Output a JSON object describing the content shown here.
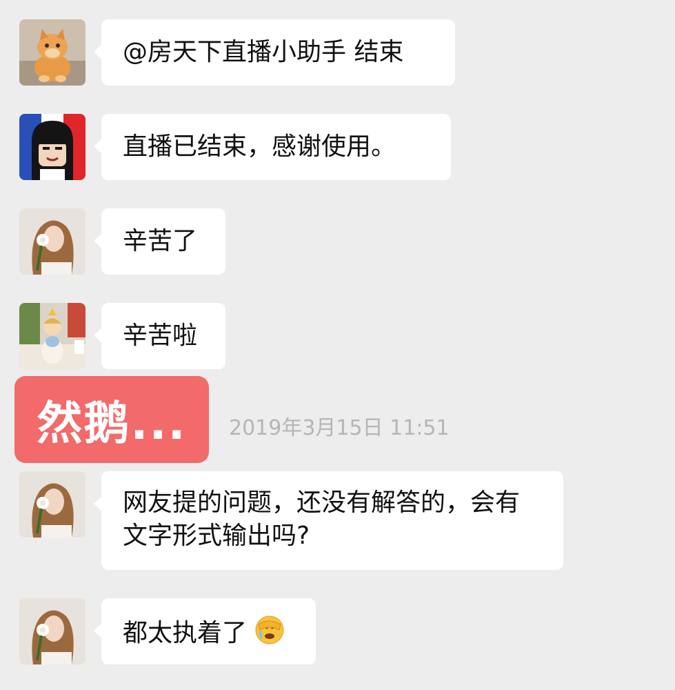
{
  "messages": [
    {
      "avatar": "cat-avatar",
      "text": "@房天下直播小助手 结束"
    },
    {
      "avatar": "cartoon-girl-avatar",
      "text": "直播已结束，感谢使用。"
    },
    {
      "avatar": "woman-with-flower-avatar",
      "text": "辛苦了"
    },
    {
      "avatar": "doll-figurine-avatar",
      "text": "辛苦啦"
    },
    {
      "avatar": "woman-with-flower-avatar",
      "text": "网友提的问题，还没有解答的，会有文字形式输出吗?"
    },
    {
      "avatar": "woman-with-flower-avatar",
      "text": "都太执着了",
      "emoji": "facepalm-emoji"
    }
  ],
  "divider": {
    "badge": "然鹅...",
    "timestamp": "2019年3月15日 11:51"
  },
  "colors": {
    "background": "#ededed",
    "bubble": "#ffffff",
    "badge": "#f26a6a",
    "timestamp": "#b5b5b5"
  }
}
